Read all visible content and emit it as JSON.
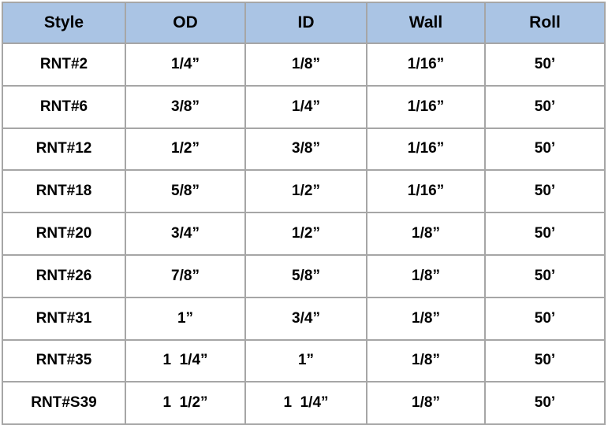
{
  "table": {
    "columns": [
      {
        "key": "style",
        "label": "Style"
      },
      {
        "key": "od",
        "label": "OD"
      },
      {
        "key": "id",
        "label": "ID"
      },
      {
        "key": "wall",
        "label": "Wall"
      },
      {
        "key": "roll",
        "label": "Roll"
      }
    ],
    "rows": [
      {
        "style": "RNT#2",
        "od": "1/4”",
        "id": "1/8”",
        "wall": "1/16”",
        "roll": "50’"
      },
      {
        "style": "RNT#6",
        "od": "3/8”",
        "id": "1/4”",
        "wall": "1/16”",
        "roll": "50’"
      },
      {
        "style": "RNT#12",
        "od": "1/2”",
        "id": "3/8”",
        "wall": "1/16”",
        "roll": "50’"
      },
      {
        "style": "RNT#18",
        "od": "5/8”",
        "id": "1/2”",
        "wall": "1/16”",
        "roll": "50’"
      },
      {
        "style": "RNT#20",
        "od": "3/4”",
        "id": "1/2”",
        "wall": "1/8”",
        "roll": "50’"
      },
      {
        "style": "RNT#26",
        "od": "7/8”",
        "id": "5/8”",
        "wall": "1/8”",
        "roll": "50’"
      },
      {
        "style": "RNT#31",
        "od": "1”",
        "id": "3/4”",
        "wall": "1/8”",
        "roll": "50’"
      },
      {
        "style": "RNT#35",
        "od": "1  1/4”",
        "id": "1”",
        "wall": "1/8”",
        "roll": "50’"
      },
      {
        "style": "RNT#S39",
        "od": "1  1/2”",
        "id": "1  1/4”",
        "wall": "1/8”",
        "roll": "50’"
      }
    ]
  },
  "colors": {
    "header_background": "#aac4e4",
    "cell_background": "#ffffff",
    "border": "#a6a6a6",
    "text": "#000000"
  }
}
